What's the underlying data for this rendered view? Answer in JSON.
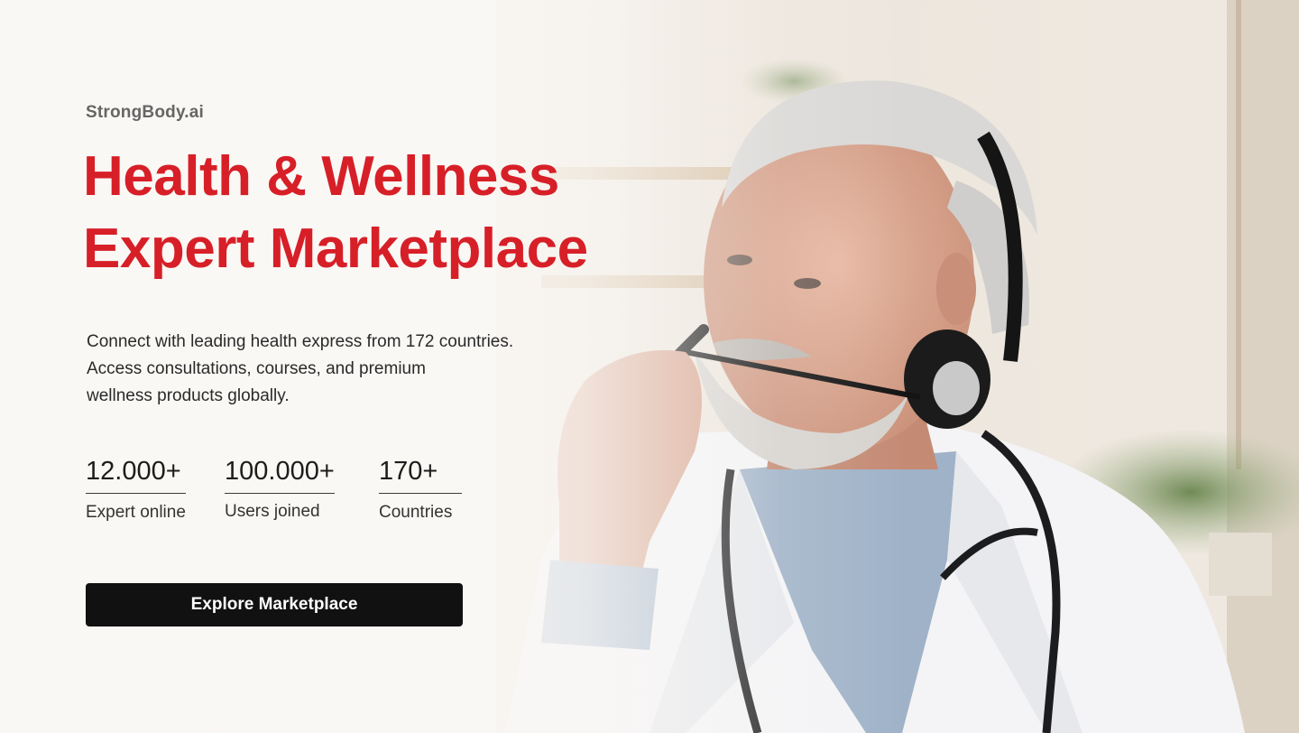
{
  "brand": {
    "name": "StrongBody.ai"
  },
  "hero": {
    "headline_line1": "Health & Wellness",
    "headline_line2": "Expert Marketplace",
    "description_line1": "Connect with leading health express from 172 countries.",
    "description_line2": "Access consultations, courses, and premium",
    "description_line3": "wellness products globally."
  },
  "stats": [
    {
      "value": "12.000+",
      "label": "Expert online"
    },
    {
      "value": "100.000+",
      "label": "Users joined"
    },
    {
      "value": "170+",
      "label": "Countries"
    }
  ],
  "cta": {
    "label": "Explore Marketplace"
  },
  "colors": {
    "accent": "#d71f28",
    "button_bg": "#111111",
    "button_text": "#ffffff"
  }
}
